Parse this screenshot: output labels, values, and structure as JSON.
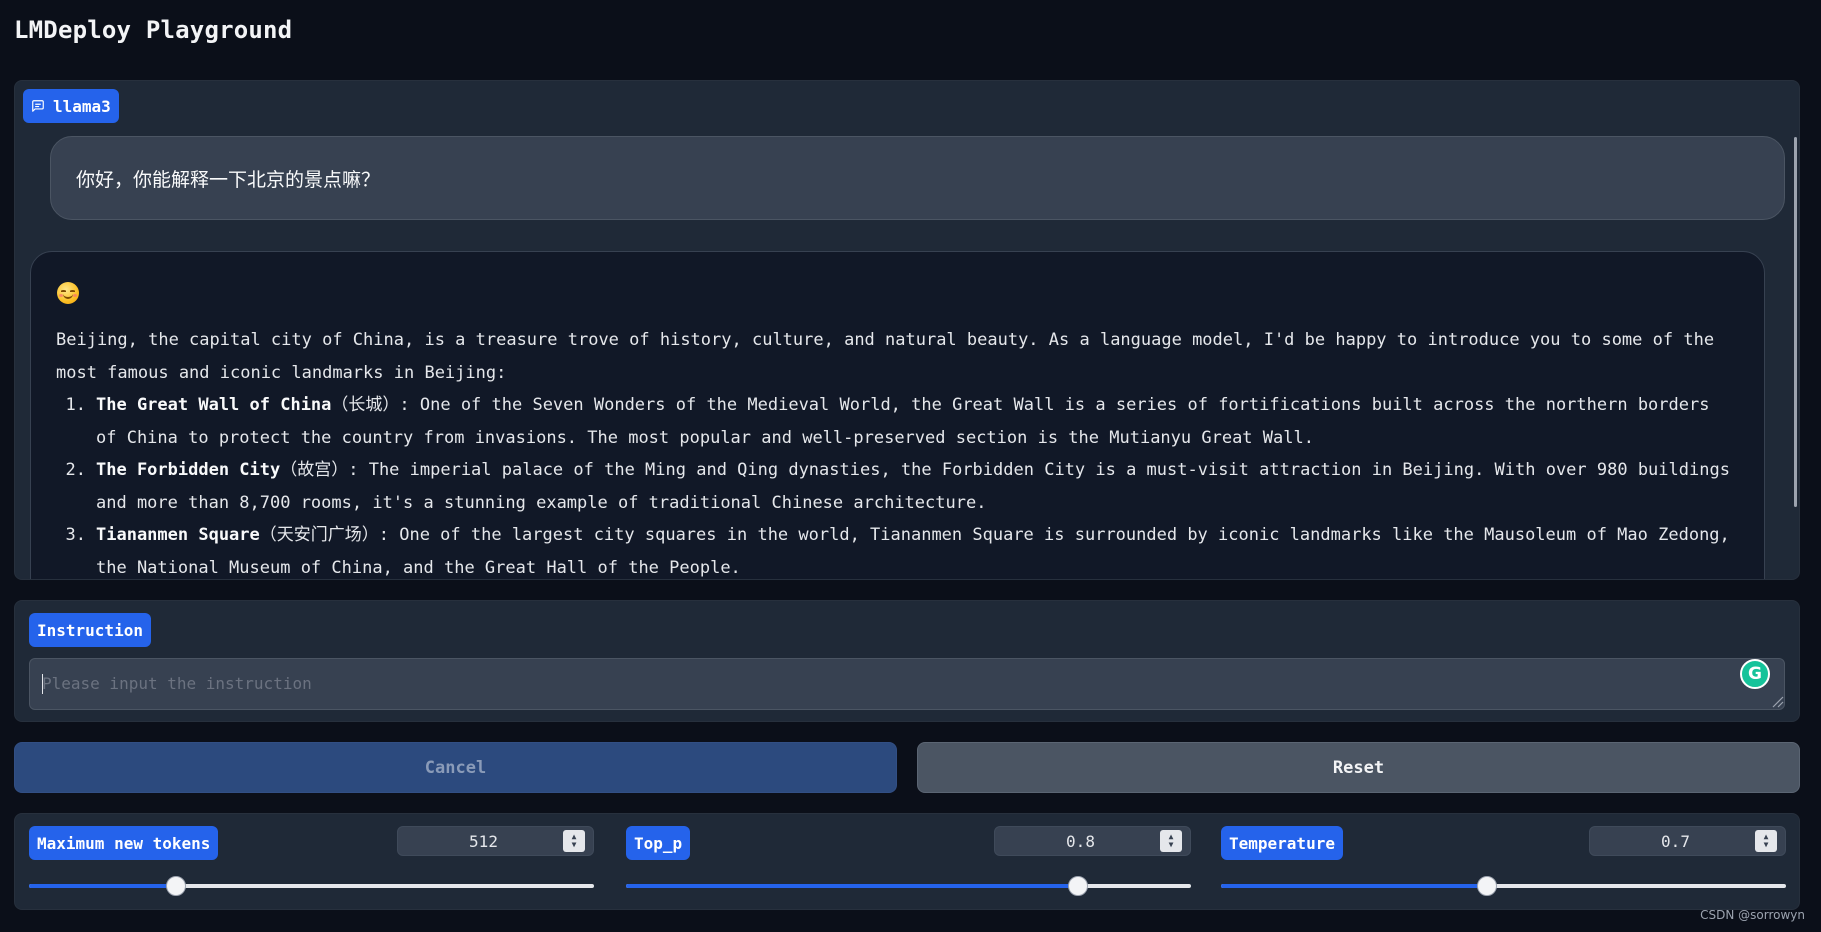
{
  "app": {
    "title": "LMDeploy Playground"
  },
  "chat": {
    "label": "llama3",
    "label_icon": "chat-icon",
    "user_message": "你好，你能解释一下北京的景点嘛？",
    "bot_emoji": "smiling-face-icon",
    "bot_intro": "Beijing, the capital city of China, is a treasure trove of history, culture, and natural beauty. As a language model, I'd be happy to introduce you to some of the most famous and iconic landmarks in Beijing:",
    "items": [
      {
        "num": "1.",
        "name": "The Great Wall of China",
        "cn": "（长城）",
        "text": ": One of the Seven Wonders of the Medieval World, the Great Wall is a series of fortifications built across the northern borders of China to protect the country from invasions. The most popular and well-preserved section is the Mutianyu Great Wall."
      },
      {
        "num": "2.",
        "name": "The Forbidden City",
        "cn": "（故宫）",
        "text": ": The imperial palace of the Ming and Qing dynasties, the Forbidden City is a must-visit attraction in Beijing. With over 980 buildings and more than 8,700 rooms, it's a stunning example of traditional Chinese architecture."
      },
      {
        "num": "3.",
        "name": "Tiananmen Square",
        "cn": "（天安门广场）",
        "text": ": One of the largest city squares in the world, Tiananmen Square is surrounded by iconic landmarks like the Mausoleum of Mao Zedong, the National Museum of China, and the Great Hall of the People."
      }
    ]
  },
  "instruction": {
    "label": "Instruction",
    "value": "",
    "placeholder": "Please input the instruction",
    "extension_icon": "grammarly-icon",
    "extension_glyph": "G"
  },
  "buttons": {
    "cancel": "Cancel",
    "reset": "Reset"
  },
  "params": [
    {
      "key": "max_tokens",
      "label": "Maximum new tokens",
      "value": "512",
      "fill": 0.26
    },
    {
      "key": "top_p",
      "label": "Top_p",
      "value": "0.8",
      "fill": 0.8
    },
    {
      "key": "temperature",
      "label": "Temperature",
      "value": "0.7",
      "fill": 0.47
    }
  ],
  "colors": {
    "accent": "#2563eb",
    "background": "#0b0f19",
    "panel": "#1f2937"
  },
  "watermark": "CSDN @sorrowyn"
}
